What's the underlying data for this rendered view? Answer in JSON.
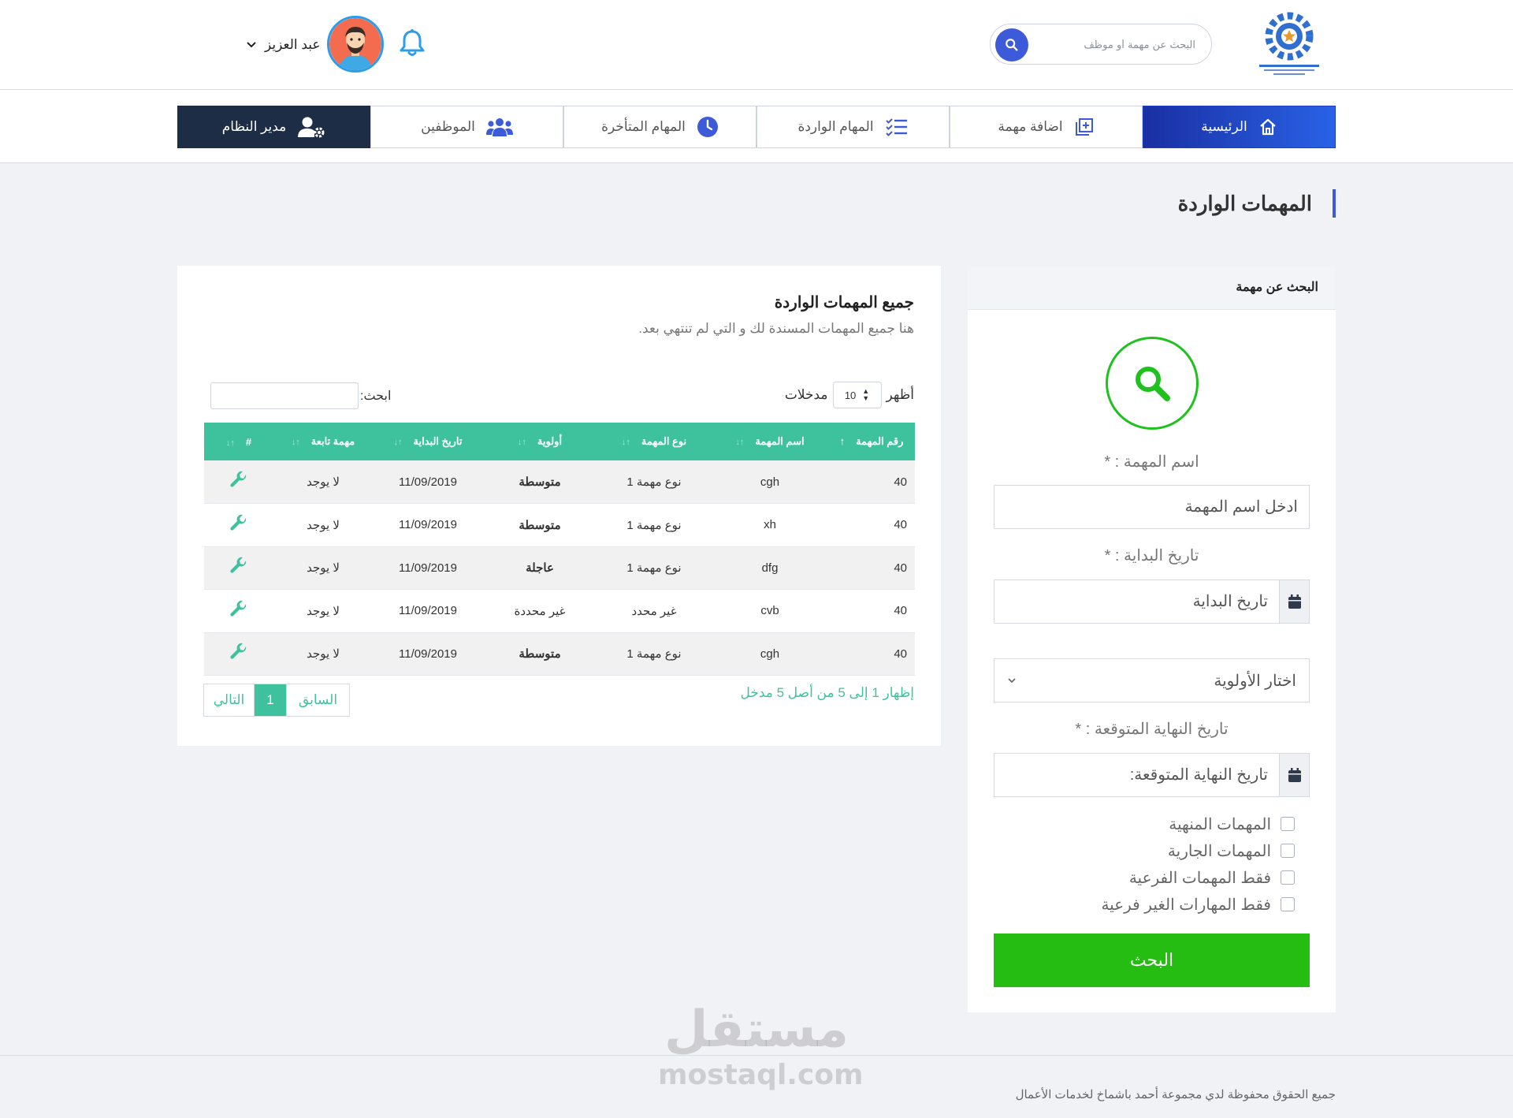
{
  "header": {
    "search_placeholder": "البحث عن مهمة أو موظف",
    "user_name": "عبد العزيز"
  },
  "nav": {
    "items": [
      {
        "label": "الرئيسية",
        "icon": "home-icon",
        "active": true
      },
      {
        "label": "اضافة مهمة",
        "icon": "add-square-icon"
      },
      {
        "label": "المهام الواردة",
        "icon": "checklist-icon"
      },
      {
        "label": "المهام المتأخرة",
        "icon": "clock-icon"
      },
      {
        "label": "الموظفين",
        "icon": "users-icon"
      },
      {
        "label": "مدير النظام",
        "icon": "user-gear-icon"
      }
    ]
  },
  "page": {
    "title": "المهمات الواردة"
  },
  "search_panel": {
    "title": "البحث عن مهمة",
    "task_name_label": "اسم المهمة : *",
    "task_name_placeholder": "ادخل اسم المهمة",
    "start_date_label": "تاريخ البداية : *",
    "start_date_placeholder": "تاريخ البداية",
    "priority_placeholder": "اختار الأولوية",
    "end_date_label": "تاريخ النهاية المتوقعة : *",
    "end_date_placeholder": "تاريخ النهاية المتوقعة:",
    "checks": [
      "المهمات المنهية",
      "المهمات الجارية",
      "فقط المهمات الفرعية",
      "فقط المهارات الغير فرعية"
    ],
    "submit_label": "البحث"
  },
  "table_card": {
    "title": "جميع المهمات الواردة",
    "subtitle": "هنا جميع المهمات المسندة لك و التي لم تنتهي بعد.",
    "show_label": "أظهر",
    "entries_label": "مدخلات",
    "page_size": "10",
    "filter_label": "ابحث:",
    "columns": [
      "رقم المهمة",
      "اسم المهمة",
      "نوع المهمة",
      "أولوية",
      "تاريخ البداية",
      "مهمة تابعة",
      "#"
    ],
    "rows": [
      {
        "id": "40",
        "name": "cgh",
        "type": "نوع مهمة 1",
        "priority": "متوسطة",
        "priority_level": "medium",
        "start": "11/09/2019",
        "parent": "لا يوجد"
      },
      {
        "id": "40",
        "name": "xh",
        "type": "نوع مهمة 1",
        "priority": "متوسطة",
        "priority_level": "medium",
        "start": "11/09/2019",
        "parent": "لا يوجد"
      },
      {
        "id": "40",
        "name": "dfg",
        "type": "نوع مهمة 1",
        "priority": "عاجلة",
        "priority_level": "urgent",
        "start": "11/09/2019",
        "parent": "لا يوجد"
      },
      {
        "id": "40",
        "name": "cvb",
        "type": "غير محدد",
        "priority": "غير محددة",
        "priority_level": "none",
        "start": "11/09/2019",
        "parent": "لا يوجد"
      },
      {
        "id": "40",
        "name": "cgh",
        "type": "نوع مهمة 1",
        "priority": "متوسطة",
        "priority_level": "medium",
        "start": "11/09/2019",
        "parent": "لا يوجد"
      }
    ],
    "info": "إظهار 1 إلى 5 من أصل 5 مدخل",
    "pager": {
      "prev": "السابق",
      "current": "1",
      "next": "التالي"
    }
  },
  "footer": {
    "text": "جميع الحقوق محفوظة لدي مجموعة أحمد باشماخ لخدمات الأعمال"
  },
  "watermark": {
    "arabic": "مستقل",
    "latin": "mostaql.com"
  },
  "colors": {
    "brand_blue": "#3d5bd9",
    "teal": "#3ec29e",
    "green_button": "#26bd12",
    "admin_dark": "#1c2d45",
    "priority_medium": "#f08030",
    "priority_urgent": "#e44c2c"
  }
}
